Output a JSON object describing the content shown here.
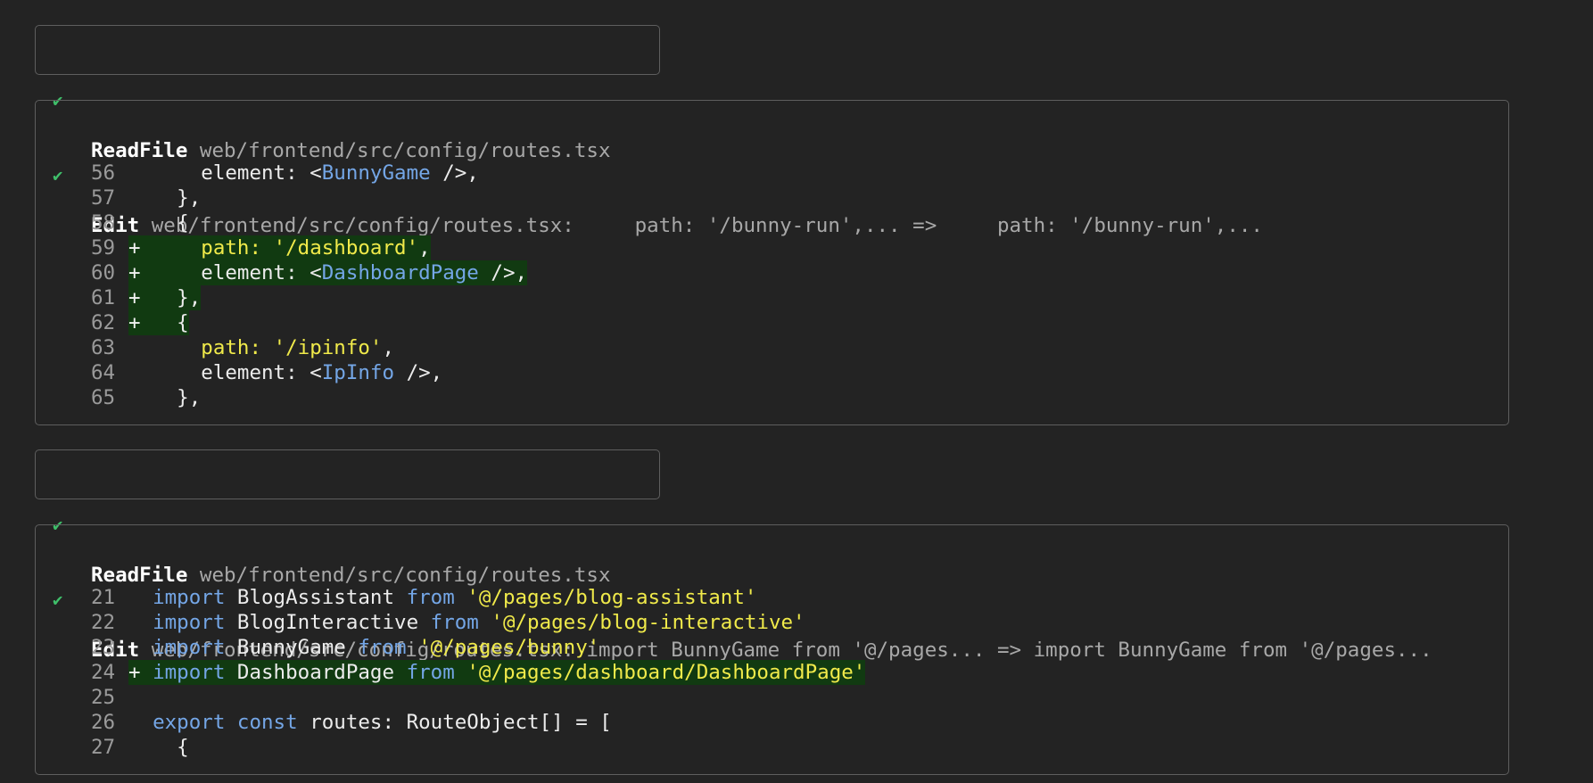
{
  "blocks": [
    {
      "kind": "readfile",
      "tool": "ReadFile",
      "path": "web/frontend/src/config/routes.tsx"
    },
    {
      "kind": "edit",
      "tool": "Edit",
      "summary": "web/frontend/src/config/routes.tsx:     path: '/bunny-run',... =>     path: '/bunny-run',...",
      "lines": [
        {
          "n": "56",
          "mark": " ",
          "added": false,
          "tokens": [
            {
              "t": "    element: <",
              "c": "plain"
            },
            {
              "t": "BunnyGame",
              "c": "comp"
            },
            {
              "t": " />,",
              "c": "plain"
            }
          ]
        },
        {
          "n": "57",
          "mark": " ",
          "added": false,
          "tokens": [
            {
              "t": "  },",
              "c": "plain"
            }
          ]
        },
        {
          "n": "58",
          "mark": " ",
          "added": false,
          "tokens": [
            {
              "t": "  {",
              "c": "plain"
            }
          ]
        },
        {
          "n": "59",
          "mark": "+",
          "added": true,
          "tokens": [
            {
              "t": "    path: ",
              "c": "str"
            },
            {
              "t": "'/dashboard'",
              "c": "str"
            },
            {
              "t": ",",
              "c": "plain"
            }
          ]
        },
        {
          "n": "60",
          "mark": "+",
          "added": true,
          "tokens": [
            {
              "t": "    element: <",
              "c": "plain"
            },
            {
              "t": "DashboardPage",
              "c": "comp"
            },
            {
              "t": " />,",
              "c": "plain"
            }
          ]
        },
        {
          "n": "61",
          "mark": "+",
          "added": true,
          "tokens": [
            {
              "t": "  },",
              "c": "plain"
            }
          ]
        },
        {
          "n": "62",
          "mark": "+",
          "added": true,
          "tokens": [
            {
              "t": "  {",
              "c": "plain"
            }
          ]
        },
        {
          "n": "63",
          "mark": " ",
          "added": false,
          "tokens": [
            {
              "t": "    path: ",
              "c": "str"
            },
            {
              "t": "'/ipinfo'",
              "c": "str"
            },
            {
              "t": ",",
              "c": "plain"
            }
          ]
        },
        {
          "n": "64",
          "mark": " ",
          "added": false,
          "tokens": [
            {
              "t": "    element: <",
              "c": "plain"
            },
            {
              "t": "IpInfo",
              "c": "comp"
            },
            {
              "t": " />,",
              "c": "plain"
            }
          ]
        },
        {
          "n": "65",
          "mark": " ",
          "added": false,
          "tokens": [
            {
              "t": "  },",
              "c": "plain"
            }
          ]
        }
      ]
    },
    {
      "kind": "readfile",
      "tool": "ReadFile",
      "path": "web/frontend/src/config/routes.tsx"
    },
    {
      "kind": "edit",
      "tool": "Edit",
      "summary": "web/frontend/src/config/routes.tsx: import BunnyGame from '@/pages... => import BunnyGame from '@/pages...",
      "lines": [
        {
          "n": "21",
          "mark": " ",
          "added": false,
          "tokens": [
            {
              "t": "import",
              "c": "kw"
            },
            {
              "t": " BlogAssistant ",
              "c": "plain"
            },
            {
              "t": "from",
              "c": "kw"
            },
            {
              "t": " ",
              "c": "plain"
            },
            {
              "t": "'@/pages/blog-assistant'",
              "c": "str"
            }
          ]
        },
        {
          "n": "22",
          "mark": " ",
          "added": false,
          "tokens": [
            {
              "t": "import",
              "c": "kw"
            },
            {
              "t": " BlogInteractive ",
              "c": "plain"
            },
            {
              "t": "from",
              "c": "kw"
            },
            {
              "t": " ",
              "c": "plain"
            },
            {
              "t": "'@/pages/blog-interactive'",
              "c": "str"
            }
          ]
        },
        {
          "n": "23",
          "mark": " ",
          "added": false,
          "tokens": [
            {
              "t": "import",
              "c": "kw"
            },
            {
              "t": " BunnyGame ",
              "c": "plain"
            },
            {
              "t": "from",
              "c": "kw"
            },
            {
              "t": " ",
              "c": "plain"
            },
            {
              "t": "'@/pages/bunny'",
              "c": "str"
            }
          ]
        },
        {
          "n": "24",
          "mark": "+",
          "added": true,
          "tokens": [
            {
              "t": "import",
              "c": "kw"
            },
            {
              "t": " DashboardPage ",
              "c": "plain"
            },
            {
              "t": "from",
              "c": "kw"
            },
            {
              "t": " ",
              "c": "plain"
            },
            {
              "t": "'@/pages/dashboard/DashboardPage'",
              "c": "str"
            }
          ]
        },
        {
          "n": "25",
          "mark": " ",
          "added": false,
          "tokens": [
            {
              "t": "",
              "c": "plain"
            }
          ]
        },
        {
          "n": "26",
          "mark": " ",
          "added": false,
          "tokens": [
            {
              "t": "export",
              "c": "kw"
            },
            {
              "t": " ",
              "c": "plain"
            },
            {
              "t": "const",
              "c": "kw"
            },
            {
              "t": " routes: RouteObject[] = [",
              "c": "plain"
            }
          ]
        },
        {
          "n": "27",
          "mark": " ",
          "added": false,
          "tokens": [
            {
              "t": "  {",
              "c": "plain"
            }
          ]
        }
      ]
    }
  ],
  "colors": {
    "background": "#232323",
    "border": "#5e5e5e",
    "check": "#3fbf6a",
    "added_bg": "#113a11",
    "string": "#f0ea4a",
    "component": "#74a6e6",
    "keyword": "#74a6e6"
  },
  "icons": {
    "check": "check-icon"
  },
  "check_glyph": "✔"
}
